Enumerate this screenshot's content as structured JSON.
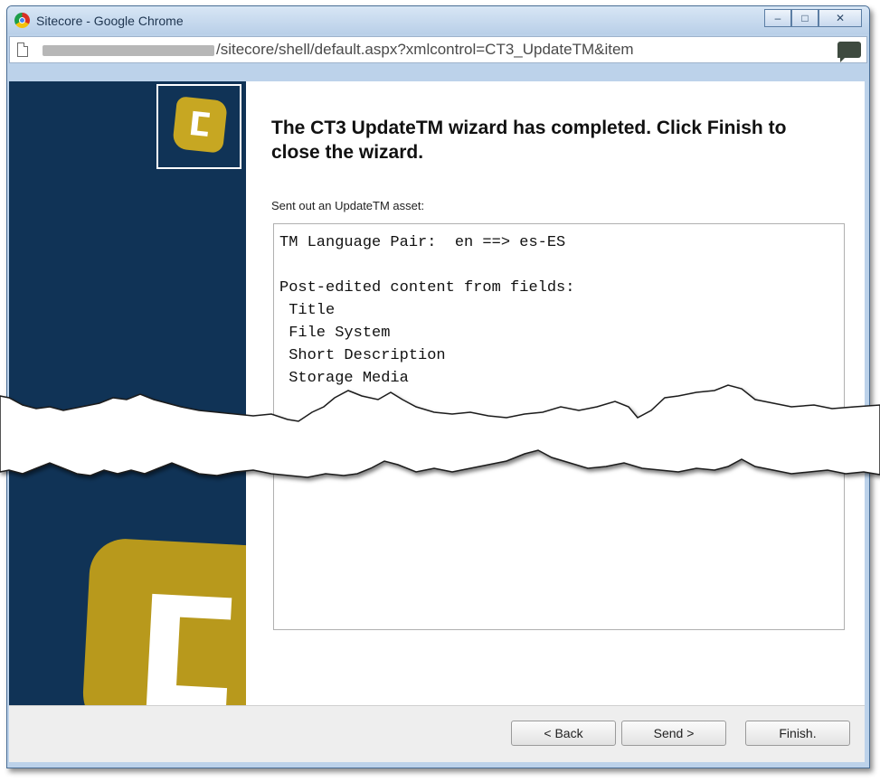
{
  "window": {
    "title": "Sitecore - Google Chrome",
    "minimize": "–",
    "maximize": "□",
    "close": "✕"
  },
  "address": {
    "url": "/sitecore/shell/default.aspx?xmlcontrol=CT3_UpdateTM&item"
  },
  "wizard": {
    "heading": "The CT3 UpdateTM wizard has completed. Click Finish to close the wizard.",
    "result_label": "Sent out an UpdateTM asset:",
    "result_lines": "TM Language Pair:  en ==> es-ES\n\nPost-edited content from fields:\n Title\n File System\n Short Description\n Storage Media"
  },
  "buttons": {
    "back": "< Back",
    "send": "Send >",
    "finish": "Finish."
  },
  "colors": {
    "sidebar": "#103356",
    "logo": "#c7a722"
  },
  "icons": [
    "chrome-icon",
    "page-icon",
    "speech-bubble-icon",
    "sitecore-logo-icon"
  ]
}
